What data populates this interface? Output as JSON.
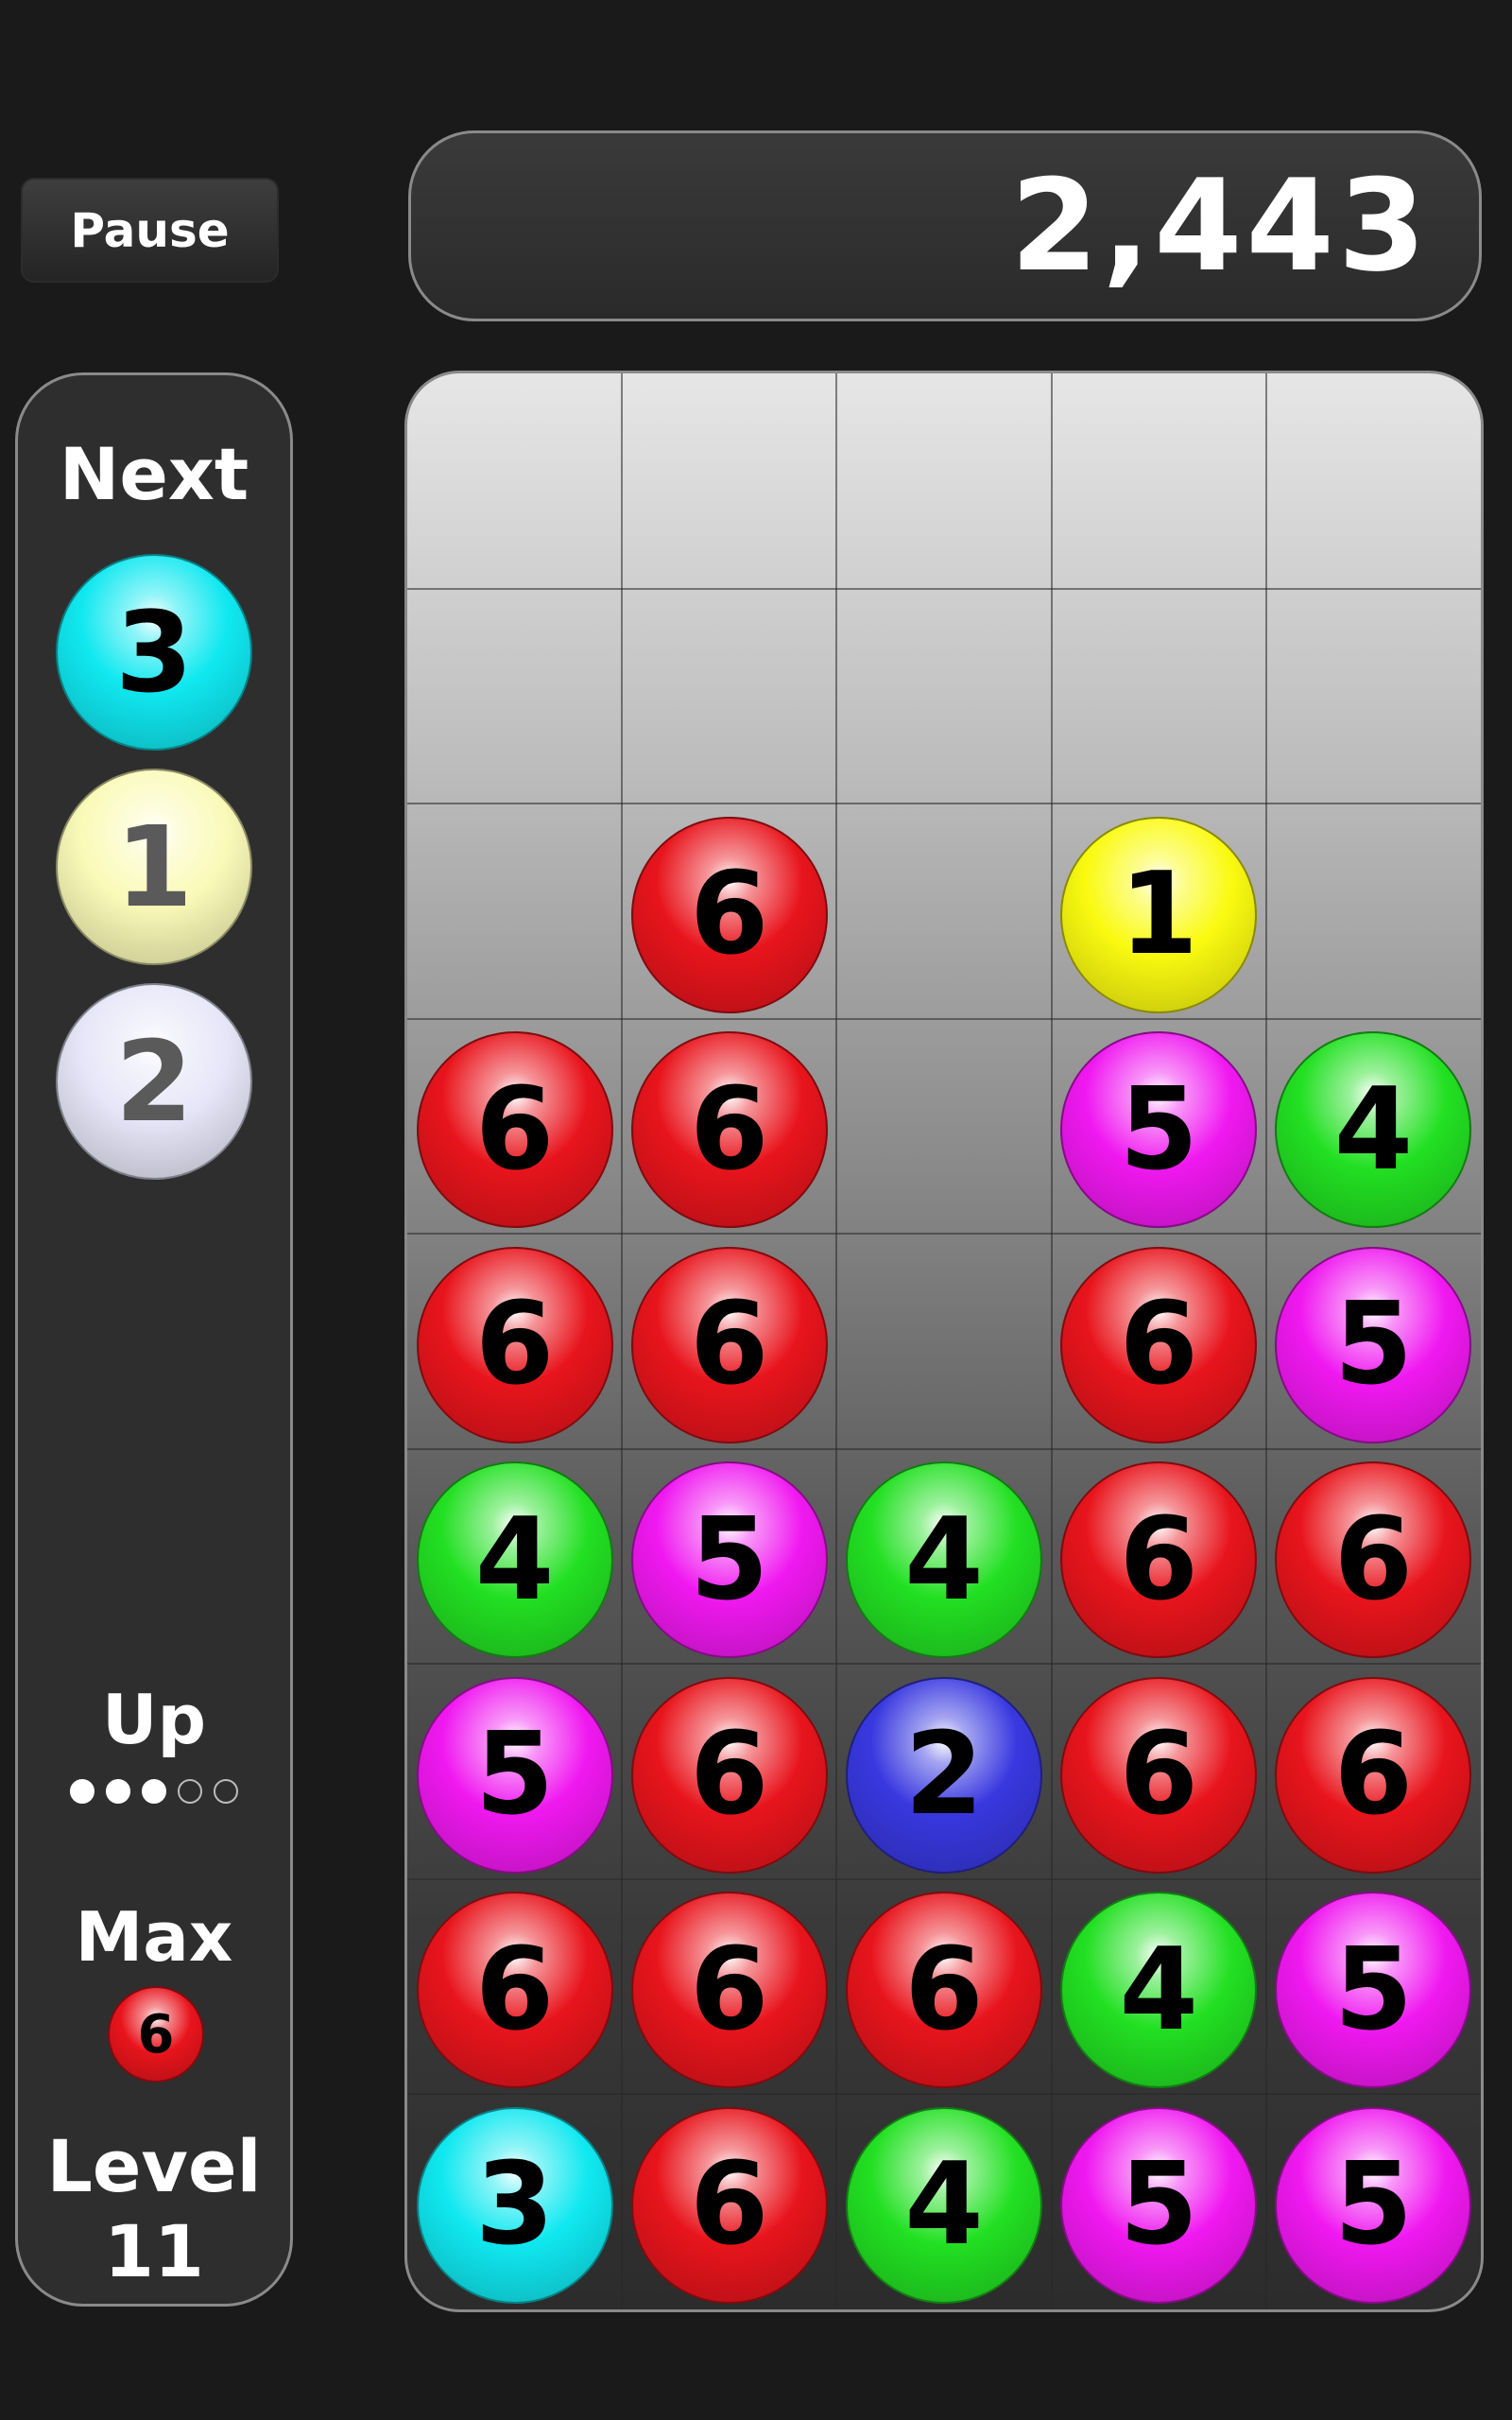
{
  "controls": {
    "pause_label": "Pause"
  },
  "score": {
    "value": "2,443"
  },
  "side_panel": {
    "next_label": "Next",
    "next_balls": [
      {
        "number": "3",
        "color": "cyan"
      },
      {
        "number": "1",
        "color": "pale-yellow"
      },
      {
        "number": "2",
        "color": "pale-lavender"
      }
    ],
    "up_label": "Up",
    "up_progress": {
      "filled": 3,
      "total": 5
    },
    "max_label": "Max",
    "max_ball": {
      "number": "6",
      "color": "red"
    },
    "level_label": "Level",
    "level_value": "11"
  },
  "colors": {
    "red": "#e8141c",
    "green": "#22e022",
    "magenta": "#f018f0",
    "yellow": "#fafa10",
    "blue": "#3838e0",
    "cyan": "#10e8f0",
    "pale-yellow": "#fafab8",
    "pale-lavender": "#e6e6f8"
  },
  "board": {
    "columns": 5,
    "rows": 9,
    "cells": [
      [
        null,
        null,
        null,
        null,
        null
      ],
      [
        null,
        null,
        null,
        null,
        null
      ],
      [
        null,
        {
          "number": "6",
          "color": "red"
        },
        null,
        {
          "number": "1",
          "color": "yellow"
        },
        null
      ],
      [
        {
          "number": "6",
          "color": "red"
        },
        {
          "number": "6",
          "color": "red"
        },
        null,
        {
          "number": "5",
          "color": "magenta"
        },
        {
          "number": "4",
          "color": "green"
        }
      ],
      [
        {
          "number": "6",
          "color": "red"
        },
        {
          "number": "6",
          "color": "red"
        },
        null,
        {
          "number": "6",
          "color": "red"
        },
        {
          "number": "5",
          "color": "magenta"
        }
      ],
      [
        {
          "number": "4",
          "color": "green"
        },
        {
          "number": "5",
          "color": "magenta"
        },
        {
          "number": "4",
          "color": "green"
        },
        {
          "number": "6",
          "color": "red"
        },
        {
          "number": "6",
          "color": "red"
        }
      ],
      [
        {
          "number": "5",
          "color": "magenta"
        },
        {
          "number": "6",
          "color": "red"
        },
        {
          "number": "2",
          "color": "blue"
        },
        {
          "number": "6",
          "color": "red"
        },
        {
          "number": "6",
          "color": "red"
        }
      ],
      [
        {
          "number": "6",
          "color": "red"
        },
        {
          "number": "6",
          "color": "red"
        },
        {
          "number": "6",
          "color": "red"
        },
        {
          "number": "4",
          "color": "green"
        },
        {
          "number": "5",
          "color": "magenta"
        }
      ],
      [
        {
          "number": "3",
          "color": "cyan"
        },
        {
          "number": "6",
          "color": "red"
        },
        {
          "number": "4",
          "color": "green"
        },
        {
          "number": "5",
          "color": "magenta"
        },
        {
          "number": "5",
          "color": "magenta"
        }
      ]
    ]
  }
}
